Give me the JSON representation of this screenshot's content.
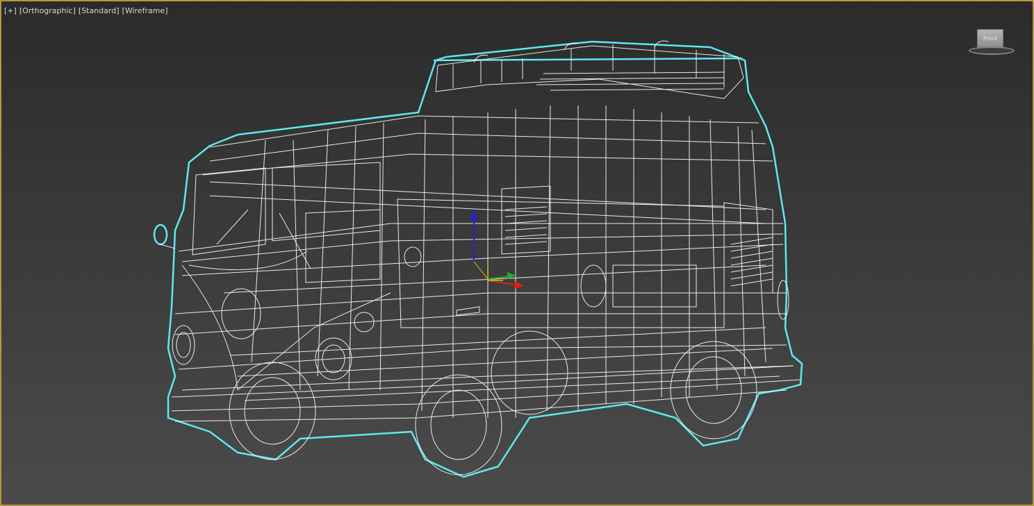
{
  "viewport": {
    "labels": {
      "plus": "[+]",
      "projection": "[Orthographic]",
      "shading_mode": "[Standard]",
      "render_style": "[Wireframe]"
    },
    "viewcube": {
      "face_label": "Front",
      "icon": "viewcube-icon"
    }
  },
  "colors": {
    "viewport_border": "#b79a3a",
    "background_top": "#2b2b2b",
    "background_bottom": "#4b4b4b",
    "selection_outline": "#5ee9f0",
    "wireframe": "#ffffff",
    "gizmo_x": "#e02020",
    "gizmo_y": "#20b020",
    "gizmo_z": "#2020e0"
  },
  "scene": {
    "object": "van-wireframe",
    "gizmo": "transform-gizmo-icon"
  }
}
